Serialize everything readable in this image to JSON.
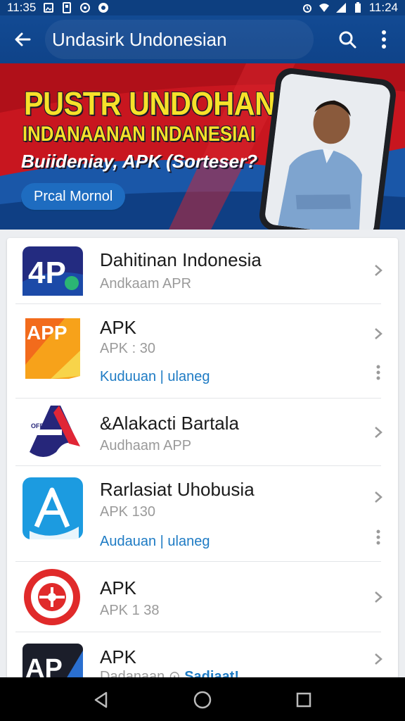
{
  "status_bar": {
    "time_left": "11:35",
    "time_right": "11:24"
  },
  "app_bar": {
    "title": "Undasirk Undonesian"
  },
  "banner": {
    "headline1": "PUSTR UNDOHAN",
    "headline2": "INDANAANAN INDANESIAI",
    "headline3": "Buiideniay, APK (Sorteser?",
    "cta": "Prcal Mornol"
  },
  "apps": [
    {
      "name": "Dahitinan Indonesia",
      "sub": "Andkaam APR",
      "icon_text": "4P"
    },
    {
      "name": "APK",
      "sub": "APK : 30",
      "link": "Kuduuan | ulaneg",
      "icon_text": "APP"
    },
    {
      "name": "&Alakacti Bartala",
      "sub": "Audhaam APP",
      "icon_text": "OFFITAT"
    },
    {
      "name": "Rarlasiat Uhobusia",
      "sub": "APK 130",
      "link": "Audauan | ulaneg"
    },
    {
      "name": "APK",
      "sub": "APK 1 38"
    },
    {
      "name": "APK",
      "sub": "Dadanaan",
      "link": "Sadiaat!",
      "icon_text": "AP"
    }
  ],
  "colors": {
    "brand_blue": "#0f4389",
    "banner_red": "#c8161f",
    "headline_yellow": "#f7e12a",
    "link_blue": "#1e7bc4"
  }
}
